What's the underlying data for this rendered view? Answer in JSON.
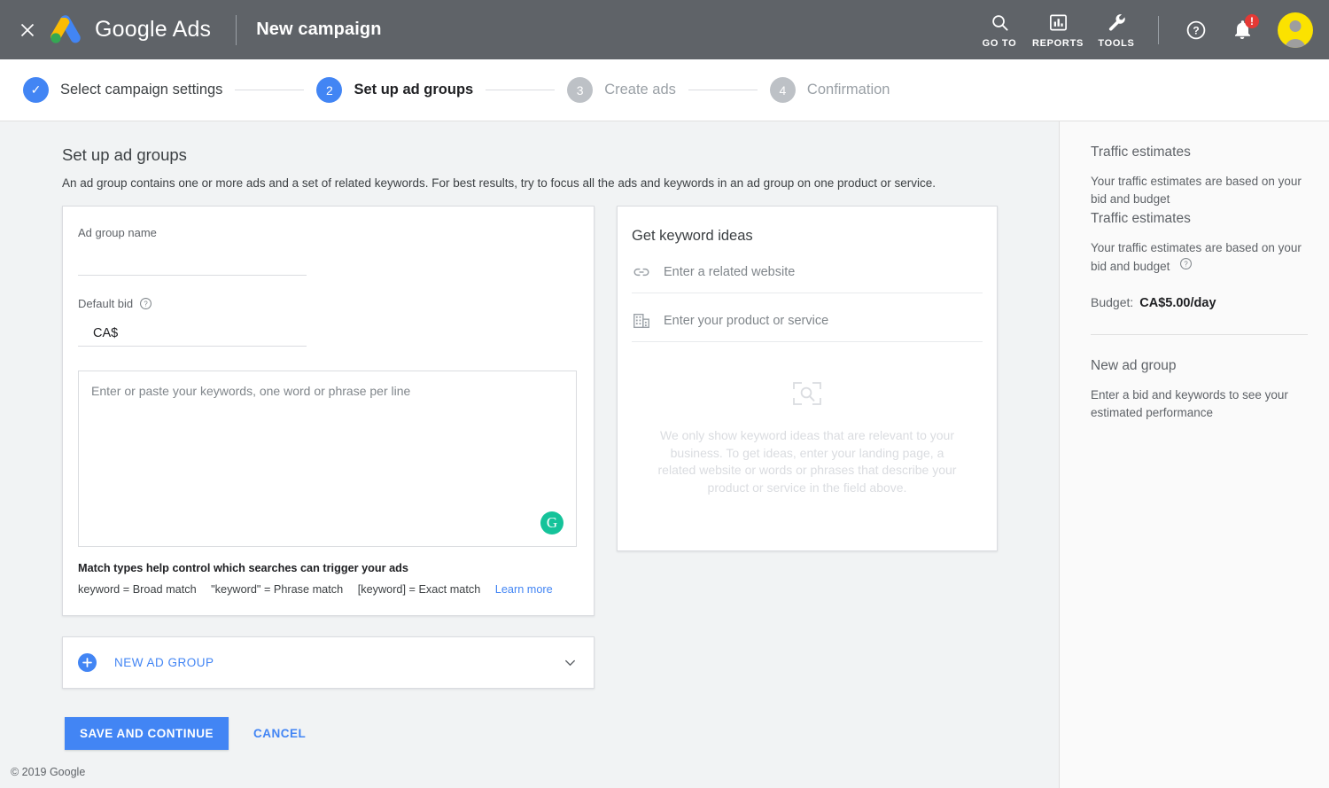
{
  "topbar": {
    "close_icon": "close-icon",
    "logo_icon": "google-ads-logo",
    "wordmark": "Google Ads",
    "campaign_title": "New campaign",
    "actions": [
      {
        "icon": "search-icon",
        "label": "GO TO"
      },
      {
        "icon": "bar-chart-icon",
        "label": "REPORTS"
      },
      {
        "icon": "wrench-icon",
        "label": "TOOLS"
      }
    ],
    "help_icon": "help-circle-icon",
    "notifications_icon": "bell-icon",
    "notification_badge": "!",
    "avatar": "user-avatar"
  },
  "stepper": {
    "steps": [
      {
        "marker": "✓",
        "label": "Select campaign settings",
        "state": "done"
      },
      {
        "marker": "2",
        "label": "Set up ad groups",
        "state": "active"
      },
      {
        "marker": "3",
        "label": "Create ads",
        "state": "todo"
      },
      {
        "marker": "4",
        "label": "Confirmation",
        "state": "todo"
      }
    ]
  },
  "page": {
    "title": "Set up ad groups",
    "subtitle": "An ad group contains one or more ads and a set of related keywords. For best results, try to focus all the ads and keywords in an ad group on one product or service."
  },
  "ad_group": {
    "name_label": "Ad group name",
    "name_value": "",
    "name_placeholder": "",
    "bid_label": "Default bid",
    "bid_help_icon": "help-circle-icon",
    "bid_currency": "CA$",
    "bid_value": "",
    "keywords_placeholder": "Enter or paste your keywords, one word or phrase per line",
    "keywords_value": "",
    "grammarly_icon": "grammarly-icon",
    "grammarly_glyph": "G",
    "match_title": "Match types help control which searches can trigger your ads",
    "match_broad": "keyword = Broad match",
    "match_phrase": "\"keyword\" = Phrase match",
    "match_exact": "[keyword] = Exact match",
    "learn_more": "Learn more"
  },
  "keyword_ideas": {
    "title": "Get keyword ideas",
    "rows": [
      {
        "icon": "link-icon",
        "placeholder": "Enter a related website",
        "value": ""
      },
      {
        "icon": "building-icon",
        "placeholder": "Enter your product or service",
        "value": ""
      }
    ],
    "empty_icon": "search-in-frame-icon",
    "empty_text": "We only show keyword ideas that are relevant to your business. To get ideas, enter your landing page, a related website or words or phrases that describe your product or service in the field above."
  },
  "new_ad_group_row": {
    "plus_icon": "plus-circle-icon",
    "label": "NEW AD GROUP",
    "chevron_icon": "chevron-down-icon"
  },
  "actions": {
    "save_label": "SAVE AND CONTINUE",
    "cancel_label": "CANCEL"
  },
  "sidebar": {
    "ghost_title": "Traffic estimates",
    "ghost_body": "Your traffic estimates are based on your bid and budget",
    "traffic_title": "Traffic estimates",
    "traffic_body": "Your traffic estimates are based on your bid and budget",
    "traffic_help_icon": "help-circle-icon",
    "budget_label": "Budget:",
    "budget_value": "CA$5.00/day",
    "new_group_title": "New ad group",
    "new_group_body": "Enter a bid and keywords to see your estimated performance"
  },
  "footer": {
    "copyright": "© 2019 Google"
  },
  "colors": {
    "header_bg": "#5f6368",
    "accent_blue": "#4285f4",
    "page_bg": "#f1f3f4",
    "grammarly_green": "#15c39a",
    "badge_red": "#e53935",
    "avatar_yellow": "#fbe200"
  }
}
